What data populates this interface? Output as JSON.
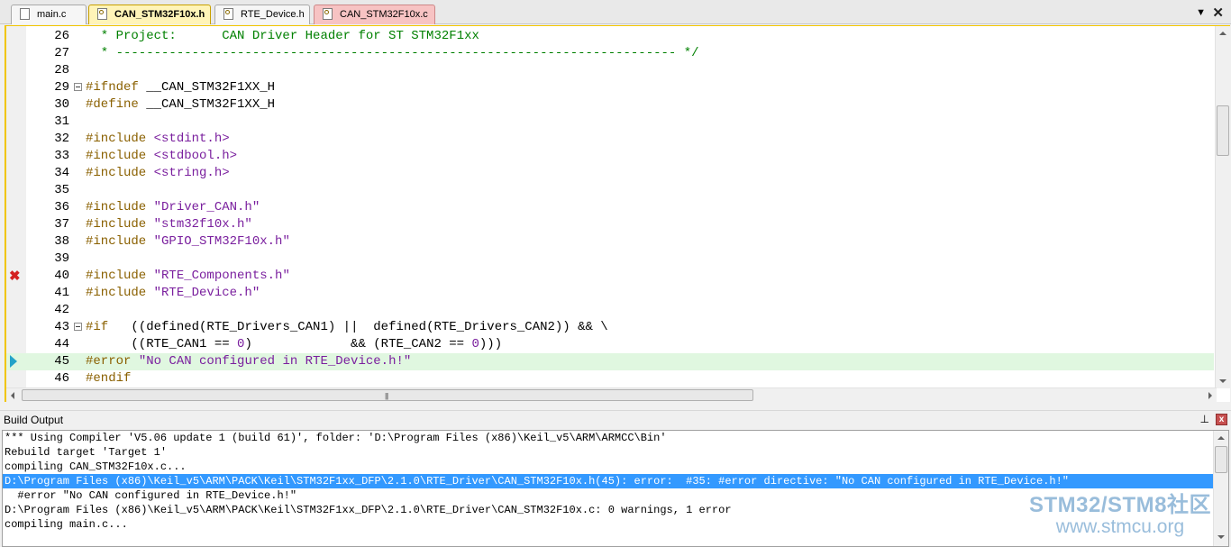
{
  "tabs": [
    {
      "label": "main.c",
      "style": "plain",
      "icon": "file-icon"
    },
    {
      "label": "CAN_STM32F10x.h",
      "style": "active",
      "icon": "locked-file-icon"
    },
    {
      "label": "RTE_Device.h",
      "style": "plain",
      "icon": "locked-file-icon"
    },
    {
      "label": "CAN_STM32F10x.c",
      "style": "red",
      "icon": "locked-file-icon"
    }
  ],
  "tab_controls": {
    "dropdown": "▼",
    "close": "✕"
  },
  "editor": {
    "lines": [
      {
        "num": "26",
        "segments": [
          {
            "t": "  * Project:      CAN Driver Header for ST STM32F1xx",
            "c": "cm"
          }
        ]
      },
      {
        "num": "27",
        "segments": [
          {
            "t": "  * -------------------------------------------------------------------------- */",
            "c": "cm"
          }
        ]
      },
      {
        "num": "28",
        "segments": []
      },
      {
        "num": "29",
        "fold": true,
        "segments": [
          {
            "t": "#ifndef",
            "c": "pp"
          },
          {
            "t": " __CAN_STM32F1XX_H",
            "c": ""
          }
        ]
      },
      {
        "num": "30",
        "segments": [
          {
            "t": "#define",
            "c": "pp"
          },
          {
            "t": " __CAN_STM32F1XX_H",
            "c": ""
          }
        ]
      },
      {
        "num": "31",
        "segments": []
      },
      {
        "num": "32",
        "segments": [
          {
            "t": "#include",
            "c": "pp"
          },
          {
            "t": " <stdint.h>",
            "c": "str"
          }
        ]
      },
      {
        "num": "33",
        "segments": [
          {
            "t": "#include",
            "c": "pp"
          },
          {
            "t": " <stdbool.h>",
            "c": "str"
          }
        ]
      },
      {
        "num": "34",
        "segments": [
          {
            "t": "#include",
            "c": "pp"
          },
          {
            "t": " <string.h>",
            "c": "str"
          }
        ]
      },
      {
        "num": "35",
        "segments": []
      },
      {
        "num": "36",
        "segments": [
          {
            "t": "#include",
            "c": "pp"
          },
          {
            "t": " \"Driver_CAN.h\"",
            "c": "str"
          }
        ]
      },
      {
        "num": "37",
        "segments": [
          {
            "t": "#include",
            "c": "pp"
          },
          {
            "t": " \"stm32f10x.h\"",
            "c": "str"
          }
        ]
      },
      {
        "num": "38",
        "segments": [
          {
            "t": "#include",
            "c": "pp"
          },
          {
            "t": " \"GPIO_STM32F10x.h\"",
            "c": "str"
          }
        ]
      },
      {
        "num": "39",
        "segments": []
      },
      {
        "num": "40",
        "error": true,
        "segments": [
          {
            "t": "#include",
            "c": "pp"
          },
          {
            "t": " \"RTE_Components.h\"",
            "c": "str"
          }
        ]
      },
      {
        "num": "41",
        "segments": [
          {
            "t": "#include",
            "c": "pp"
          },
          {
            "t": " \"RTE_Device.h\"",
            "c": "str"
          }
        ]
      },
      {
        "num": "42",
        "segments": []
      },
      {
        "num": "43",
        "fold": true,
        "segments": [
          {
            "t": "#if",
            "c": "pp"
          },
          {
            "t": "   ((defined(RTE_Drivers_CAN1) ||  defined(RTE_Drivers_CAN2)) && \\",
            "c": ""
          }
        ]
      },
      {
        "num": "44",
        "segments": [
          {
            "t": "      ((RTE_CAN1 == ",
            "c": ""
          },
          {
            "t": "0",
            "c": "num"
          },
          {
            "t": ")             && (RTE_CAN2 == ",
            "c": ""
          },
          {
            "t": "0",
            "c": "num"
          },
          {
            "t": ")))",
            "c": ""
          }
        ]
      },
      {
        "num": "45",
        "current": true,
        "segments": [
          {
            "t": "#error",
            "c": "pp"
          },
          {
            "t": " \"No CAN configured in RTE_Device.h!\"",
            "c": "str"
          }
        ]
      },
      {
        "num": "46",
        "segments": [
          {
            "t": "#endif",
            "c": "pp"
          }
        ]
      }
    ]
  },
  "build_output": {
    "title": "Build Output",
    "pin": "⊥",
    "close": "x",
    "lines": [
      {
        "text": "*** Using Compiler 'V5.06 update 1 (build 61)', folder: 'D:\\Program Files (x86)\\Keil_v5\\ARM\\ARMCC\\Bin'",
        "selected": false
      },
      {
        "text": "Rebuild target 'Target 1'",
        "selected": false
      },
      {
        "text": "compiling CAN_STM32F10x.c...",
        "selected": false
      },
      {
        "text": "D:\\Program Files (x86)\\Keil_v5\\ARM\\PACK\\Keil\\STM32F1xx_DFP\\2.1.0\\RTE_Driver\\CAN_STM32F10x.h(45): error:  #35: #error directive: \"No CAN configured in RTE_Device.h!\"",
        "selected": true
      },
      {
        "text": "  #error \"No CAN configured in RTE_Device.h!\"",
        "selected": false
      },
      {
        "text": "D:\\Program Files (x86)\\Keil_v5\\ARM\\PACK\\Keil\\STM32F1xx_DFP\\2.1.0\\RTE_Driver\\CAN_STM32F10x.c: 0 warnings, 1 error",
        "selected": false
      },
      {
        "text": "compiling main.c...",
        "selected": false
      }
    ]
  },
  "watermark": {
    "line1": "STM32/STM8社区",
    "line2": "www.stmcu.org"
  },
  "icons": {
    "error_marker": "error-x-icon",
    "current_line": "current-line-arrow-icon"
  }
}
